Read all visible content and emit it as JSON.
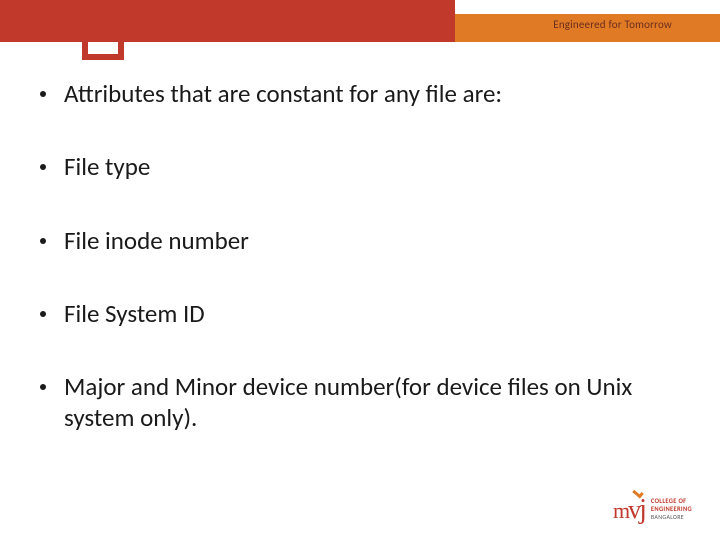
{
  "header": {
    "tagline": "Engineered for Tomorrow"
  },
  "bullets": [
    "Attributes that are constant for any file are:",
    "File type",
    "File inode number",
    "File System ID",
    "Major and Minor device number(for device files on Unix system only)."
  ],
  "logo": {
    "mark_m": "m",
    "mark_v": "v",
    "mark_j": "j",
    "line1": "COLLEGE OF",
    "line2": "ENGINEERING",
    "line3": "BANGALORE"
  }
}
